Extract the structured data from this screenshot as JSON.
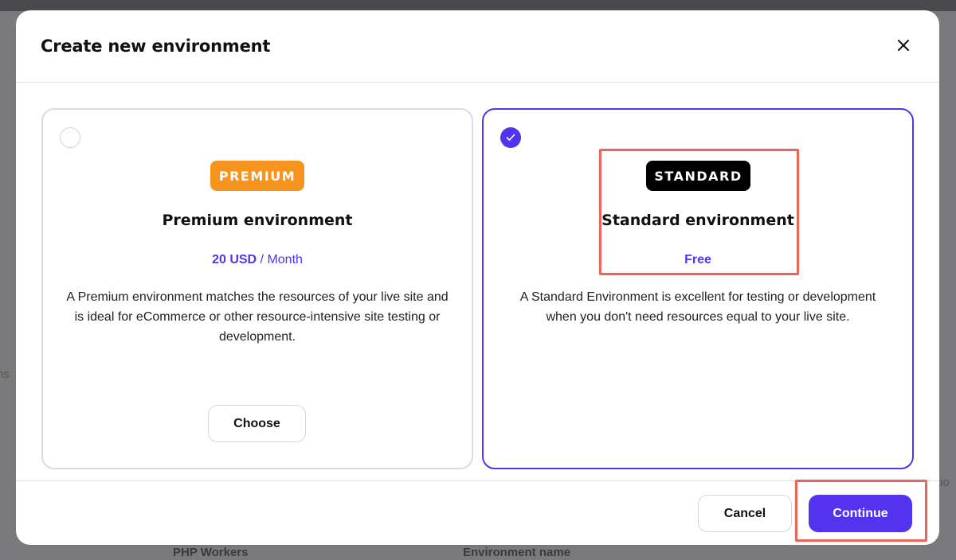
{
  "background": {
    "fragment_left": "ns",
    "fragment_right": "tio",
    "php_workers_label": "PHP Workers",
    "environment_name_label": "Environment name"
  },
  "modal": {
    "title": "Create new environment",
    "close_icon": "close-icon"
  },
  "cards": {
    "premium": {
      "selected": false,
      "badge": "PREMIUM",
      "badge_color": "#f7941d",
      "title": "Premium environment",
      "price_amount": "20 USD",
      "price_period": " / Month",
      "description": "A Premium environment matches the resources of your live site and is ideal for eCommerce or other resource-intensive site testing or development.",
      "button": "Choose"
    },
    "standard": {
      "selected": true,
      "badge": "STANDARD",
      "badge_color": "#000000",
      "title": "Standard environment",
      "price": "Free",
      "description": "A Standard Environment is excellent for testing or development when you don't need resources equal to your live site."
    }
  },
  "footer": {
    "cancel": "Cancel",
    "continue": "Continue"
  },
  "colors": {
    "accent": "#5333ed",
    "highlight": "#e8675a"
  }
}
